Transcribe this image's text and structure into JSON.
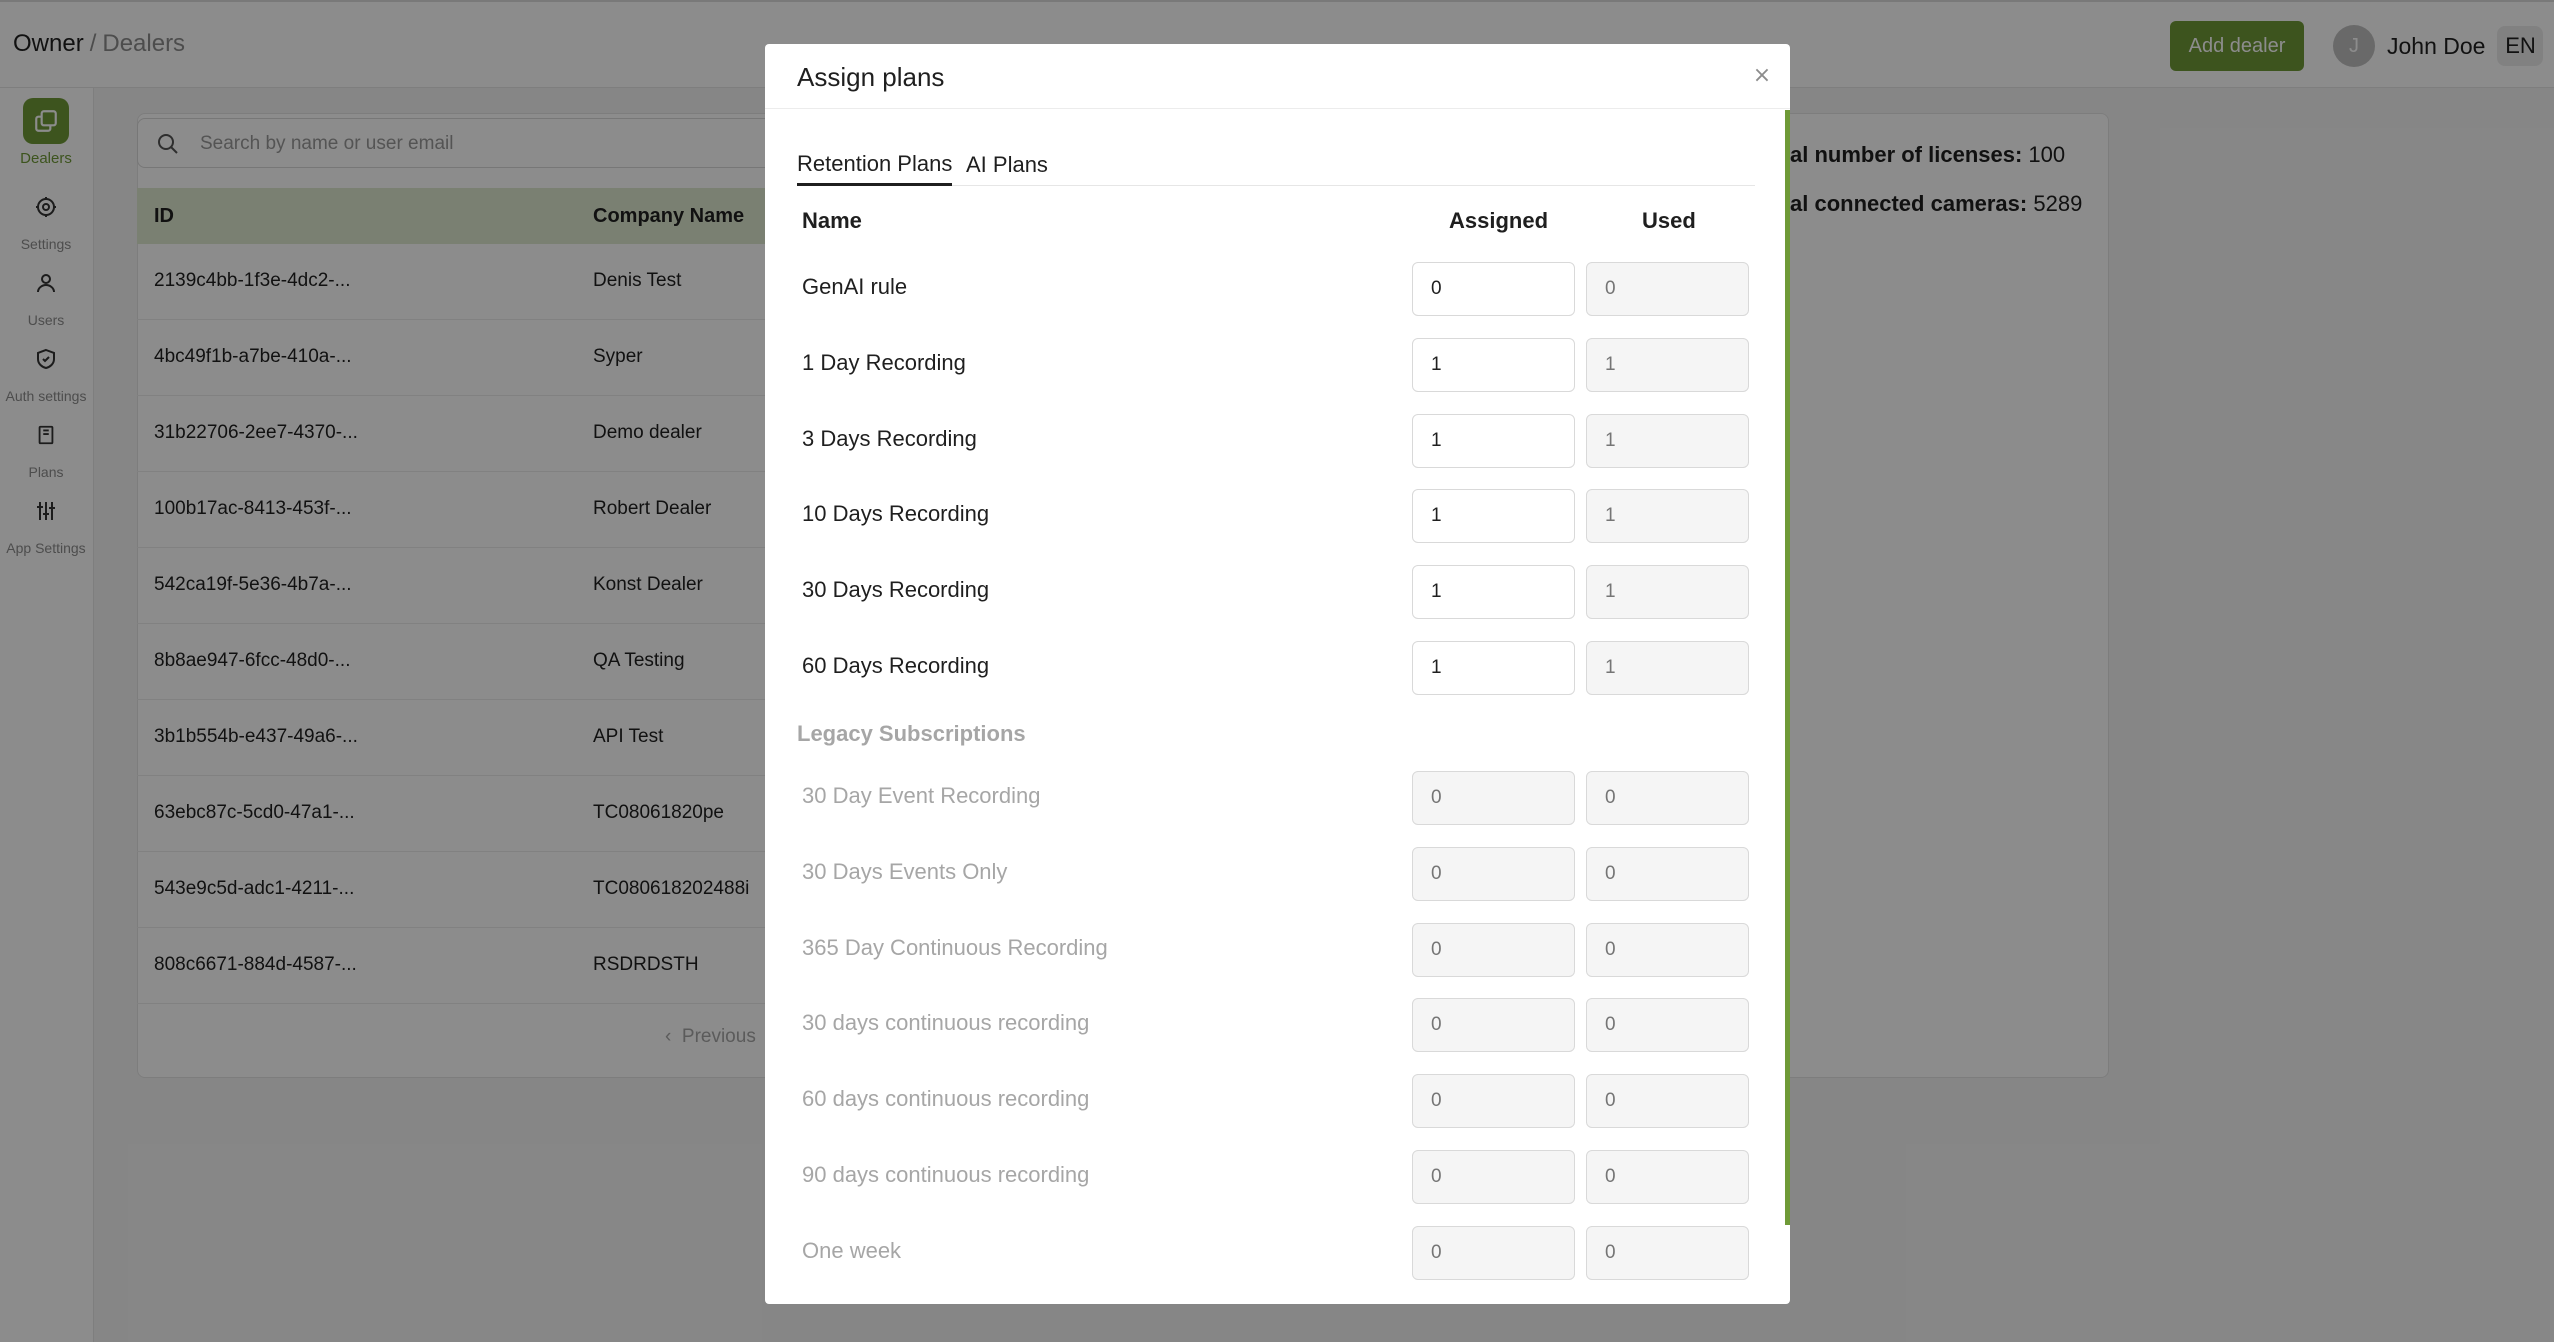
{
  "header": {
    "breadcrumb_root": "Owner",
    "breadcrumb_sep": "/",
    "breadcrumb_current": "Dealers",
    "add_dealer_label": "Add dealer",
    "user_initial": "J",
    "user_name": "John Doe",
    "language": "EN"
  },
  "sidebar": {
    "items": [
      {
        "label": "Dealers",
        "icon": "dealers-icon",
        "active": true
      },
      {
        "label": "Settings",
        "icon": "gear-icon"
      },
      {
        "label": "Users",
        "icon": "user-icon"
      },
      {
        "label": "Auth settings",
        "icon": "shield-icon"
      },
      {
        "label": "Plans",
        "icon": "book-icon"
      },
      {
        "label": "App Settings",
        "icon": "sliders-icon"
      }
    ]
  },
  "dealers": {
    "search_placeholder": "Search by name or user email",
    "columns": [
      "ID",
      "Company Name"
    ],
    "rows": [
      {
        "id": "2139c4bb-1f3e-4dc2-...",
        "company": "Denis Test"
      },
      {
        "id": "4bc49f1b-a7be-410a-...",
        "company": "Syper"
      },
      {
        "id": "31b22706-2ee7-4370-...",
        "company": "Demo dealer"
      },
      {
        "id": "100b17ac-8413-453f-...",
        "company": "Robert Dealer"
      },
      {
        "id": "542ca19f-5e36-4b7a-...",
        "company": "Konst Dealer"
      },
      {
        "id": "8b8ae947-6fcc-48d0-...",
        "company": "QA Testing"
      },
      {
        "id": "3b1b554b-e437-49a6-...",
        "company": "API Test"
      },
      {
        "id": "63ebc87c-5cd0-47a1-...",
        "company": "TC08061820pe"
      },
      {
        "id": "543e9c5d-adc1-4211-...",
        "company": "TC080618202488i"
      },
      {
        "id": "808c6671-884d-4587-...",
        "company": "RSDRDSTH"
      }
    ],
    "previous_label": "Previous"
  },
  "stats": {
    "licenses_label": "al number of licenses:",
    "licenses_value": "100",
    "cameras_label": "al connected cameras:",
    "cameras_value": "5289"
  },
  "modal": {
    "title": "Assign plans",
    "close_glyph": "×",
    "tabs": [
      "Retention Plans",
      "AI Plans"
    ],
    "columns": {
      "name": "Name",
      "assigned": "Assigned",
      "used": "Used"
    },
    "plans": [
      {
        "name": "GenAI rule",
        "assigned": "0",
        "used": "0"
      },
      {
        "name": "1 Day Recording",
        "assigned": "1",
        "used": "1"
      },
      {
        "name": "3 Days Recording",
        "assigned": "1",
        "used": "1"
      },
      {
        "name": "10 Days Recording",
        "assigned": "1",
        "used": "1"
      },
      {
        "name": "30 Days Recording",
        "assigned": "1",
        "used": "1"
      },
      {
        "name": "60 Days Recording",
        "assigned": "1",
        "used": "1"
      }
    ],
    "legacy_title": "Legacy Subscriptions",
    "legacy": [
      {
        "name": "30 Day Event Recording",
        "assigned": "0",
        "used": "0"
      },
      {
        "name": "30 Days Events Only",
        "assigned": "0",
        "used": "0"
      },
      {
        "name": "365 Day Continuous Recording",
        "assigned": "0",
        "used": "0"
      },
      {
        "name": "30 days continuous recording",
        "assigned": "0",
        "used": "0"
      },
      {
        "name": "60 days continuous recording",
        "assigned": "0",
        "used": "0"
      },
      {
        "name": "90 days continuous recording",
        "assigned": "0",
        "used": "0"
      },
      {
        "name": "One week",
        "assigned": "0",
        "used": "0"
      }
    ]
  },
  "colors": {
    "accent": "#6f9a37",
    "table_header": "#dfe9cf"
  }
}
